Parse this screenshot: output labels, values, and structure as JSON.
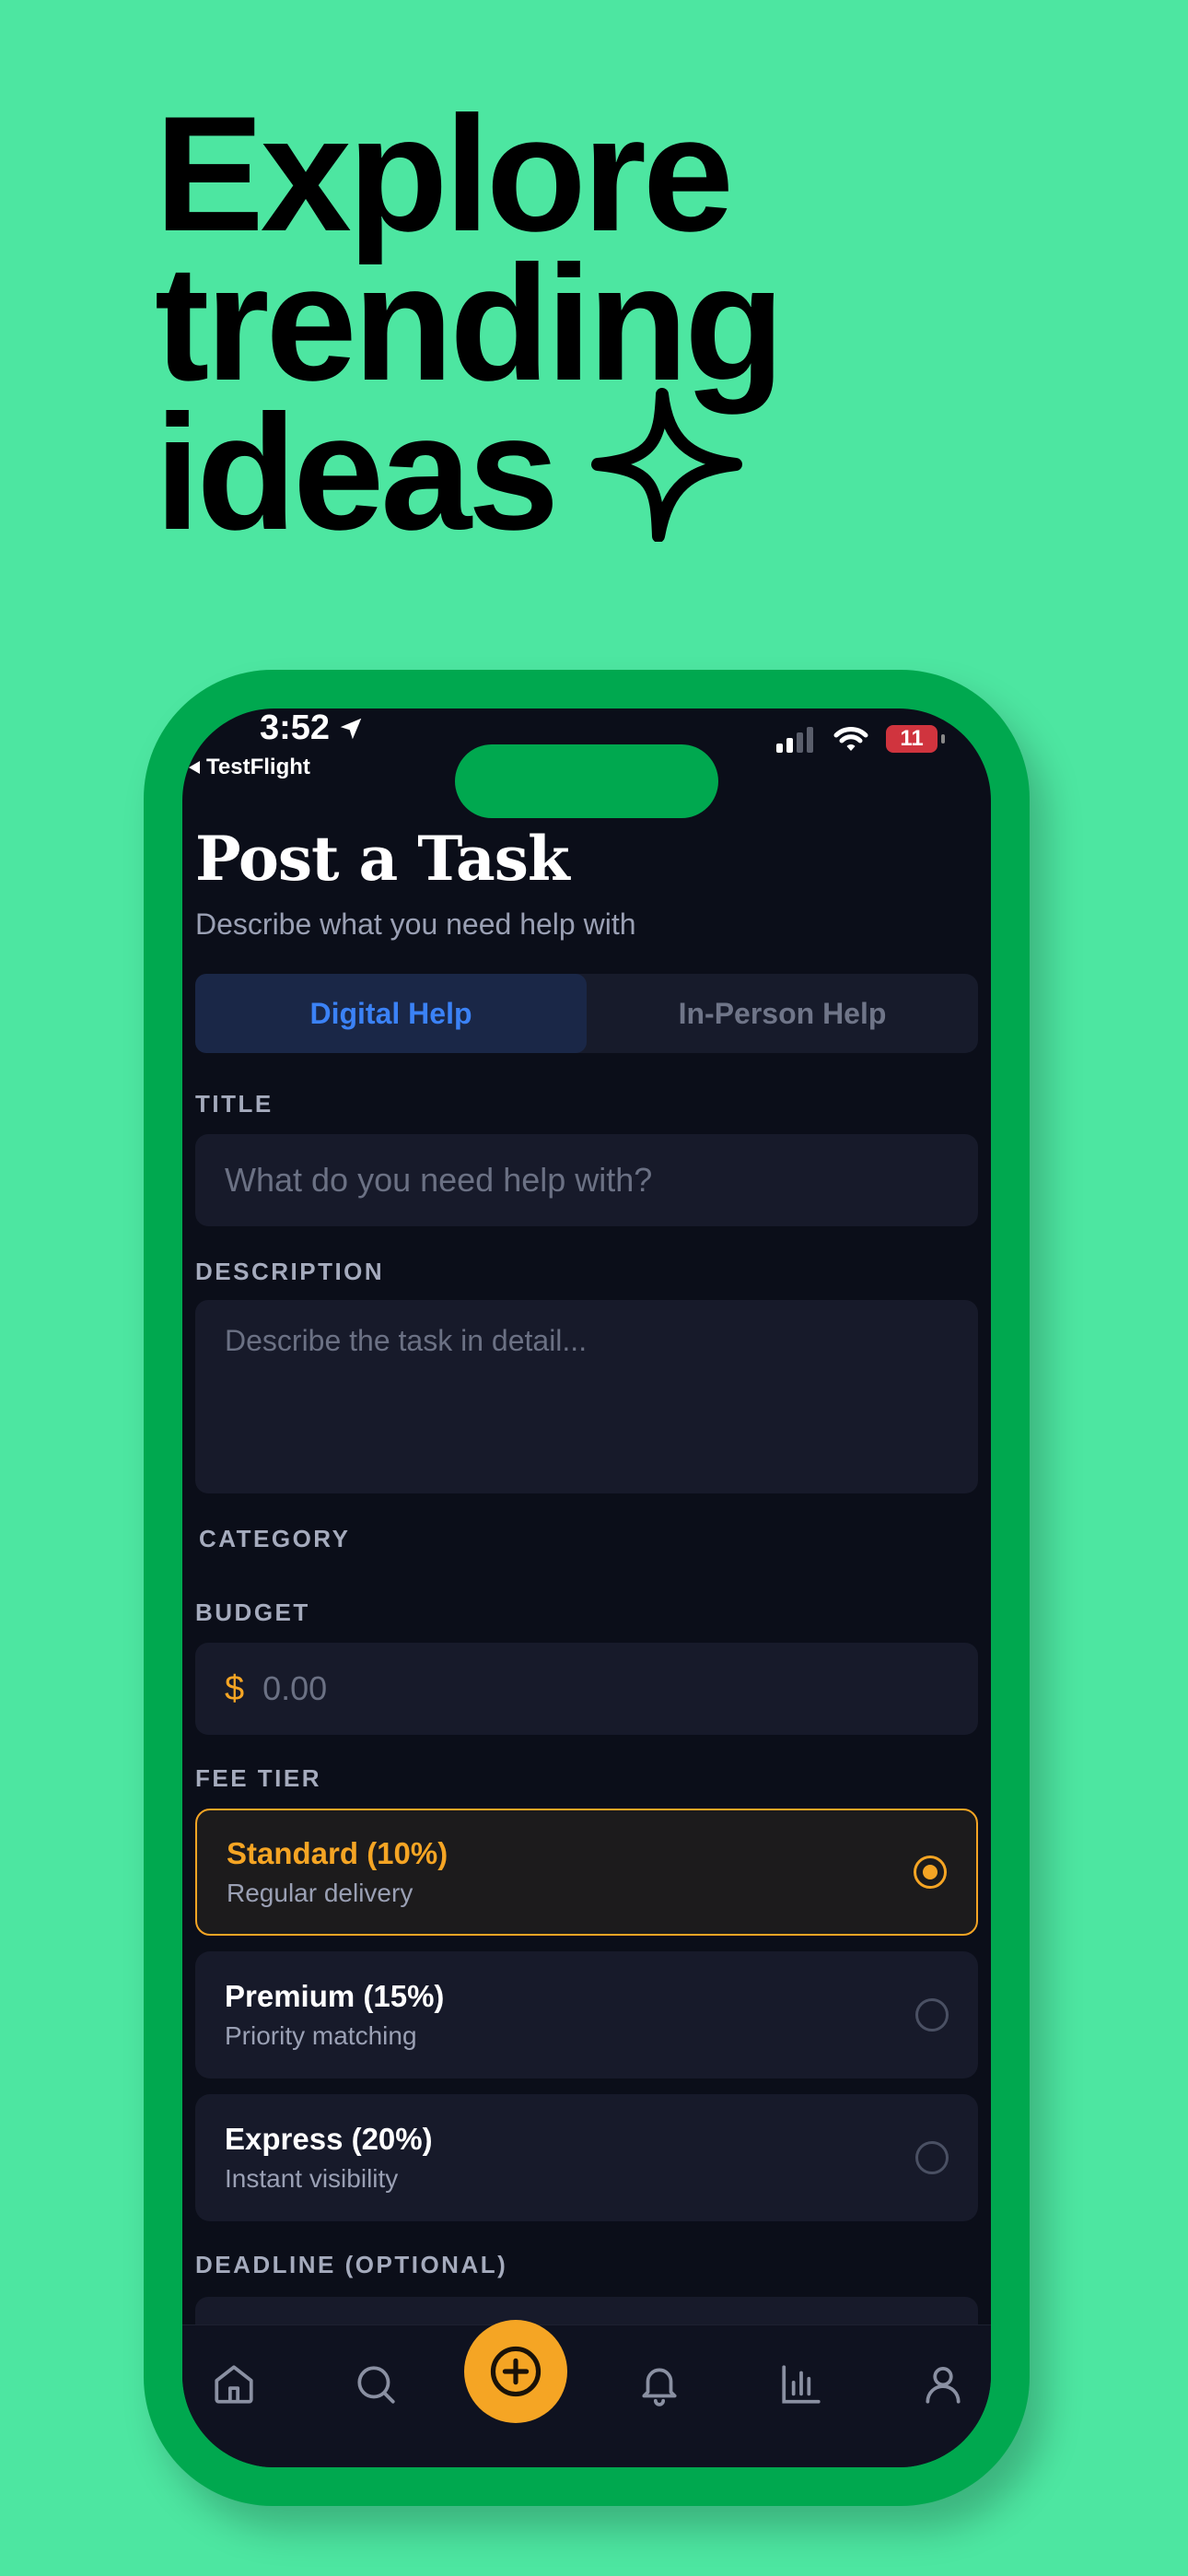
{
  "headline": {
    "line1": "Explore",
    "line2": "trending",
    "line3": "ideas"
  },
  "status_bar": {
    "time": "3:52",
    "back_app": "TestFlight",
    "battery": "11"
  },
  "page": {
    "title": "Post a Task",
    "subtitle": "Describe what you need help with"
  },
  "segments": {
    "digital": "Digital Help",
    "in_person": "In-Person Help",
    "selected": "Digital Help"
  },
  "form": {
    "title_label": "TITLE",
    "title_placeholder": "What do you need help with?",
    "description_label": "DESCRIPTION",
    "description_placeholder": "Describe the task in detail...",
    "category_label": "CATEGORY",
    "budget_label": "BUDGET",
    "budget_currency": "$",
    "budget_placeholder": "0.00",
    "fee_tier_label": "FEE TIER",
    "deadline_label": "DEADLINE (OPTIONAL)"
  },
  "fee_tiers": [
    {
      "name": "Standard (10%)",
      "sub": "Regular delivery",
      "selected": true
    },
    {
      "name": "Premium (15%)",
      "sub": "Priority matching",
      "selected": false
    },
    {
      "name": "Express (20%)",
      "sub": "Instant visibility",
      "selected": false
    }
  ],
  "tab_bar": {
    "icons": [
      "home-icon",
      "search-icon",
      "add-icon",
      "bell-icon",
      "chart-icon",
      "profile-icon"
    ]
  },
  "colors": {
    "background": "#4de6a1",
    "phone_frame": "#00a84f",
    "screen": "#0b0e19",
    "accent": "#f5a524",
    "active_segment_text": "#3b82f6"
  }
}
